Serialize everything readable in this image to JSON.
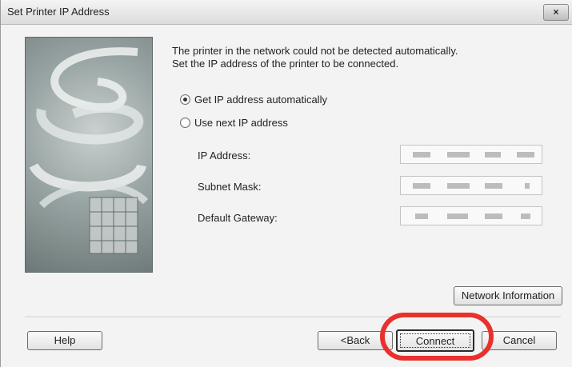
{
  "window": {
    "title": "Set Printer IP Address",
    "close_label": "×"
  },
  "message": {
    "line1": "The printer in the network could not be detected automatically.",
    "line2": "Set the IP address of the printer to be connected."
  },
  "options": [
    {
      "label": "Get IP address automatically",
      "selected": true
    },
    {
      "label": "Use next IP address",
      "selected": false
    }
  ],
  "fields": {
    "ip_address": {
      "label": "IP Address:"
    },
    "subnet_mask": {
      "label": "Subnet Mask:"
    },
    "default_gateway": {
      "label": "Default Gateway:"
    }
  },
  "buttons": {
    "network_info": "Network Information",
    "help": "Help",
    "back": "<Back",
    "connect": "Connect",
    "cancel": "Cancel"
  },
  "highlight_color": "#e8312d"
}
